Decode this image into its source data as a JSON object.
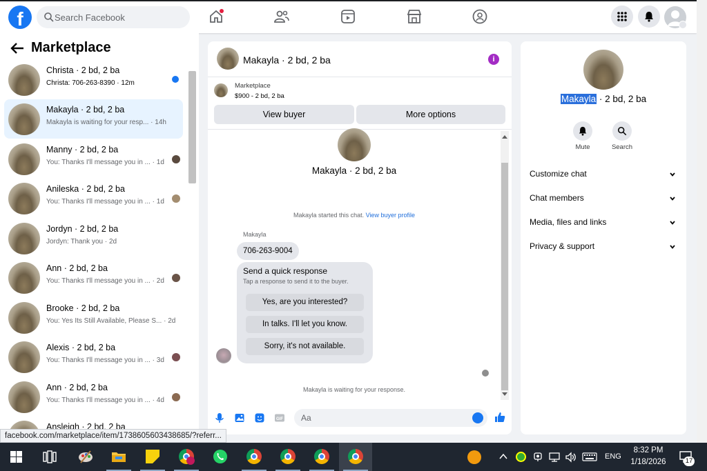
{
  "topnav": {
    "logo_letter": "f",
    "search_placeholder": "Search Facebook"
  },
  "left": {
    "title": "Marketplace",
    "conversations": [
      {
        "name": "Christa · 2 bd, 2 ba",
        "preview": "Christa: 706-263-8390 · 12m",
        "unread": true
      },
      {
        "name": "Makayla · 2 bd, 2 ba",
        "preview": "Makayla is waiting for your resp... · 14h",
        "selected": true
      },
      {
        "name": "Manny · 2 bd, 2 ba",
        "preview": "You: Thanks I'll message you in ... · 1d"
      },
      {
        "name": "Anileska · 2 bd, 2 ba",
        "preview": "You: Thanks I'll message you in ... · 1d"
      },
      {
        "name": "Jordyn · 2 bd, 2 ba",
        "preview": "Jordyn: Thank you · 2d"
      },
      {
        "name": "Ann · 2 bd, 2 ba",
        "preview": "You: Thanks I'll message you in ... · 2d"
      },
      {
        "name": "Brooke · 2 bd, 2 ba",
        "preview": "You: Yes Its Still Available, Please S... · 2d"
      },
      {
        "name": "Alexis · 2 bd, 2 ba",
        "preview": "You: Thanks I'll message you in ... · 3d"
      },
      {
        "name": "Ann · 2 bd, 2 ba",
        "preview": "You: Thanks I'll message you in ... · 4d"
      },
      {
        "name": "Ansleigh · 2 bd, 2 ba",
        "preview": ""
      }
    ]
  },
  "chat": {
    "header_title": "Makayla · 2 bd, 2 ba",
    "info_glyph": "i",
    "listing_source": "Marketplace",
    "listing_price": "$900 - 2 bd, 2 ba",
    "view_buyer": "View buyer",
    "more_options": "More options",
    "big_name": "Makayla · 2 bd, 2 ba",
    "started_text": "Makayla started this chat.",
    "view_profile_link": "View buyer profile",
    "sender_label": "Makayla",
    "phone_message": "706-263-9004",
    "quick_title": "Send a quick response",
    "quick_sub": "Tap a response to send it to the buyer.",
    "quick_options": [
      "Yes, are you interested?",
      "In talks. I'll let you know.",
      "Sorry, it's not available."
    ],
    "waiting_text": "Makayla is waiting for your response.",
    "composer_placeholder": "Aa"
  },
  "right": {
    "name_highlight": "Makayla",
    "name_rest": " · 2 bd, 2 ba",
    "mute_label": "Mute",
    "search_label": "Search",
    "rows": [
      "Customize chat",
      "Chat members",
      "Media, files and links",
      "Privacy & support"
    ]
  },
  "status_url": "facebook.com/marketplace/item/1738605603438685/?referr...",
  "taskbar": {
    "lang": "ENG",
    "time": "8:32 PM",
    "date": "1/18/2026",
    "notifications": "17"
  },
  "colors": {
    "brand": "#1877f2",
    "selected_bg": "#e7f3ff",
    "info_purple": "#a32cc4"
  }
}
